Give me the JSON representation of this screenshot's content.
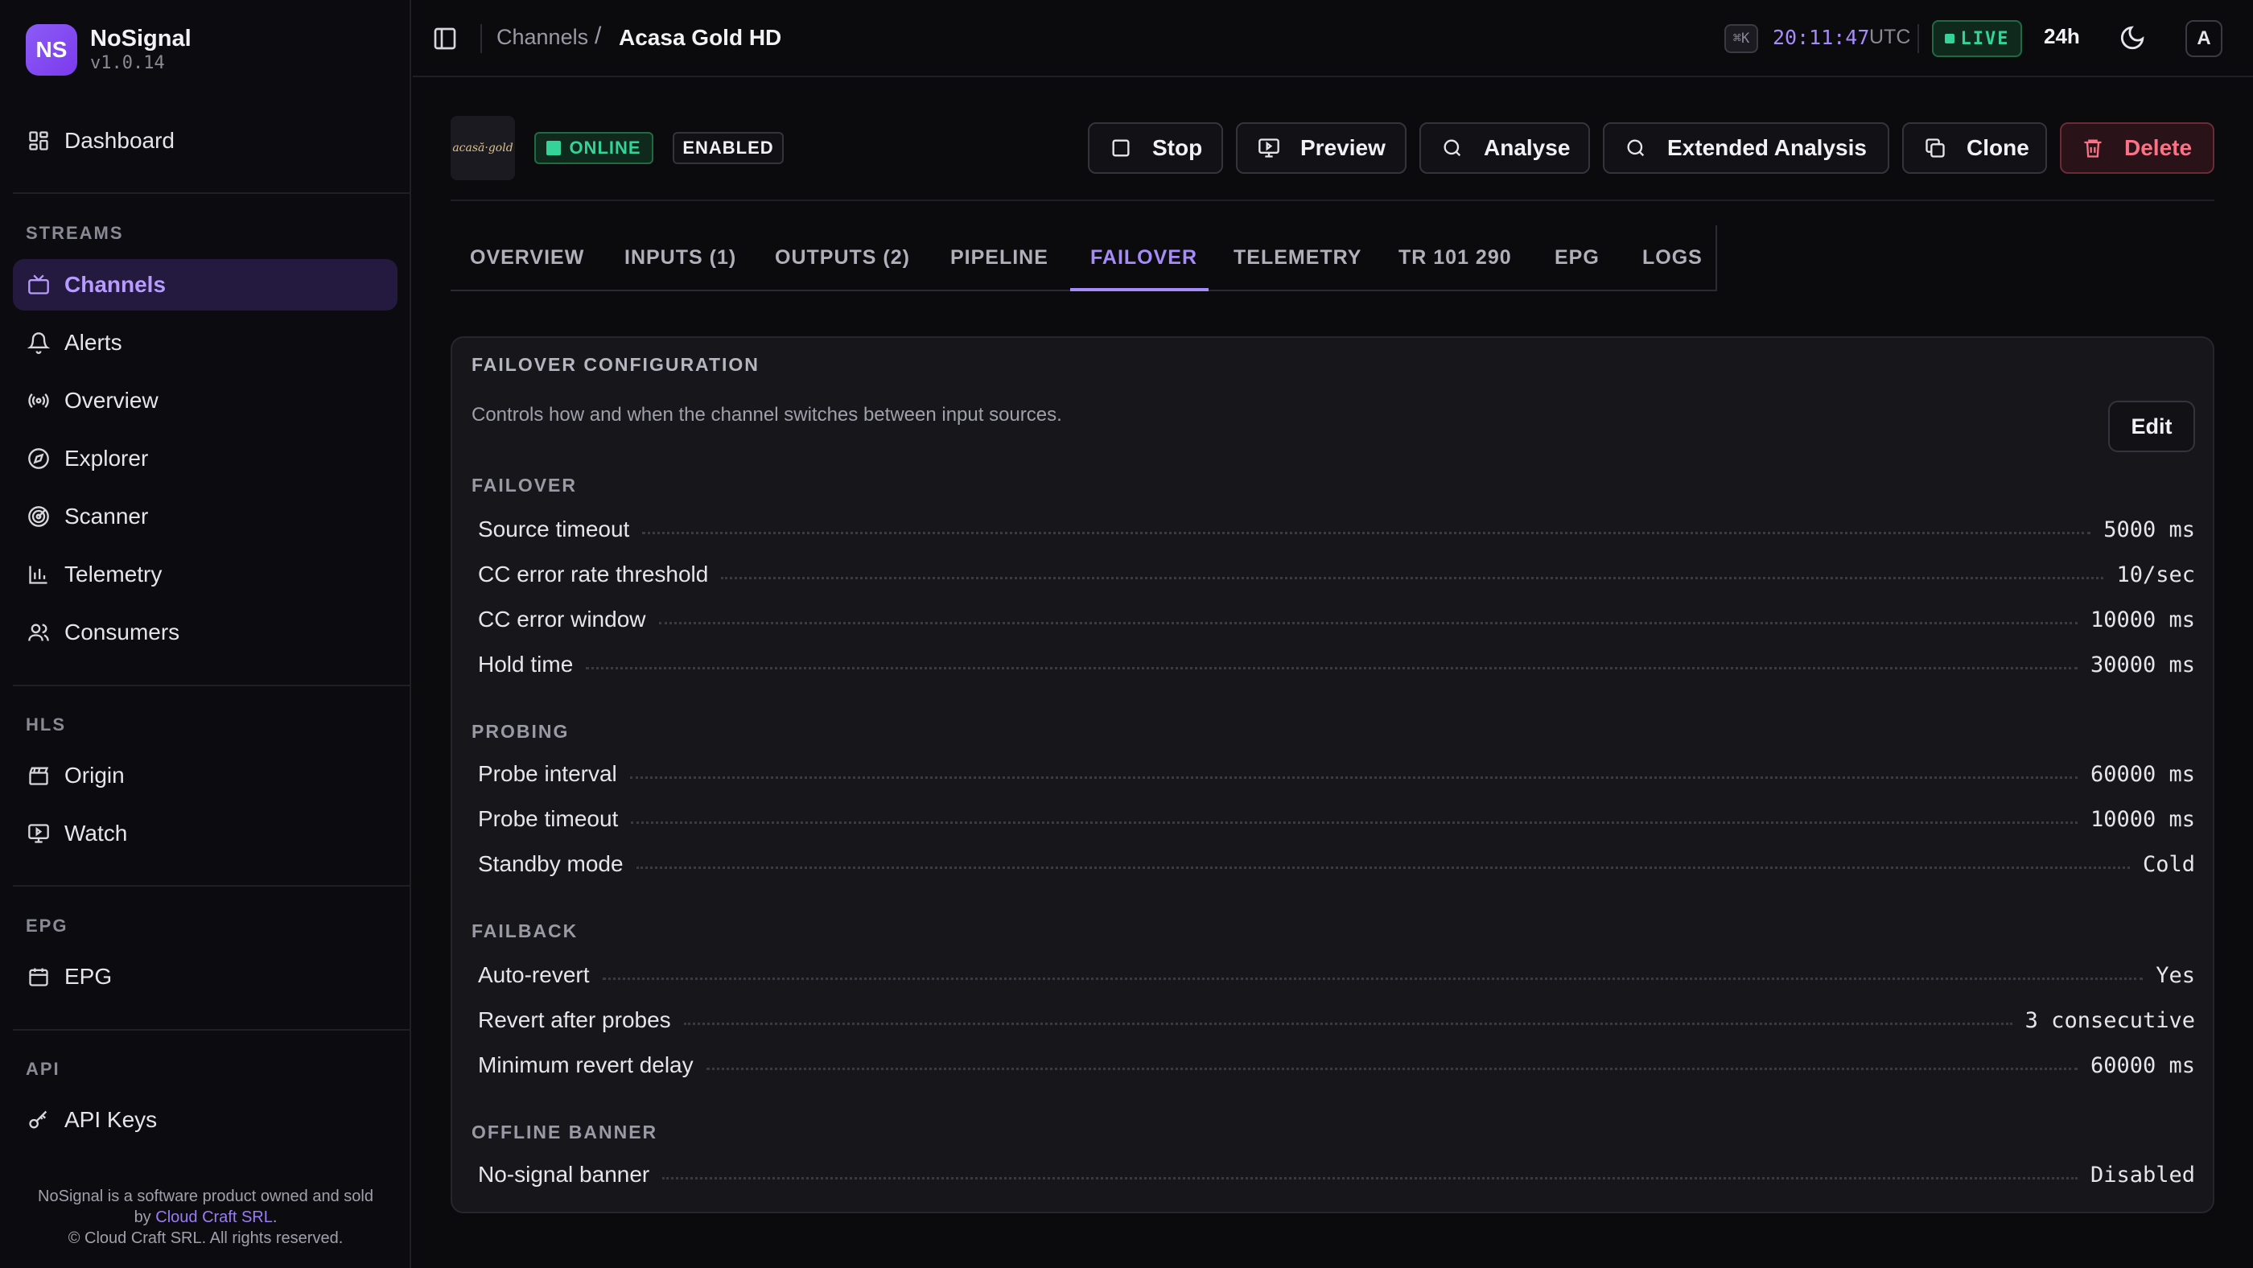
{
  "app": {
    "logo_text": "NS",
    "name": "NoSignal",
    "version": "v1.0.14"
  },
  "sidebar": {
    "dashboard": "Dashboard",
    "sections": {
      "streams": "STREAMS",
      "hls": "HLS",
      "epg": "EPG",
      "api": "API"
    },
    "streams_items": [
      "Channels",
      "Alerts",
      "Overview",
      "Explorer",
      "Scanner",
      "Telemetry",
      "Consumers"
    ],
    "hls_items": [
      "Origin",
      "Watch"
    ],
    "epg_items": [
      "EPG"
    ],
    "api_items": [
      "API Keys"
    ],
    "footer": {
      "line1": "NoSignal is a software product owned and sold",
      "by": "by ",
      "company": "Cloud Craft SRL",
      "period": ".",
      "line3": "© Cloud Craft SRL. All rights reserved."
    }
  },
  "header": {
    "breadcrumb": [
      "Channels",
      "Acasa Gold HD"
    ],
    "breadcrumb_sep": "/",
    "shortcut": "⌘K",
    "clock": "20:11:47",
    "tz": "UTC",
    "live": "LIVE",
    "range": "24h",
    "avatar": "A"
  },
  "channel": {
    "logo_text": "acasă·gold",
    "status": "ONLINE",
    "state": "ENABLED",
    "actions": [
      "Stop",
      "Preview",
      "Analyse",
      "Extended Analysis",
      "Clone",
      "Delete"
    ]
  },
  "tabs": [
    "OVERVIEW",
    "INPUTS (1)",
    "OUTPUTS (2)",
    "PIPELINE",
    "FAILOVER",
    "TELEMETRY",
    "TR 101 290",
    "EPG",
    "LOGS"
  ],
  "active_tab": "FAILOVER",
  "config": {
    "title": "FAILOVER CONFIGURATION",
    "description": "Controls how and when the channel switches between input sources.",
    "edit": "Edit",
    "sections": [
      {
        "title": "FAILOVER",
        "rows": [
          {
            "label": "Source timeout",
            "value": "5000 ms"
          },
          {
            "label": "CC error rate threshold",
            "value": "10/sec"
          },
          {
            "label": "CC error window",
            "value": "10000 ms"
          },
          {
            "label": "Hold time",
            "value": "30000 ms"
          }
        ]
      },
      {
        "title": "PROBING",
        "rows": [
          {
            "label": "Probe interval",
            "value": "60000 ms"
          },
          {
            "label": "Probe timeout",
            "value": "10000 ms"
          },
          {
            "label": "Standby mode",
            "value": "Cold"
          }
        ]
      },
      {
        "title": "FAILBACK",
        "rows": [
          {
            "label": "Auto-revert",
            "value": "Yes"
          },
          {
            "label": "Revert after probes",
            "value": "3 consecutive"
          },
          {
            "label": "Minimum revert delay",
            "value": "60000 ms"
          }
        ]
      },
      {
        "title": "OFFLINE BANNER",
        "rows": [
          {
            "label": "No-signal banner",
            "value": "Disabled"
          }
        ]
      }
    ]
  },
  "colors": {
    "accent": "#a78bfa",
    "success": "#34d399",
    "danger": "#fb7185",
    "background": "#0b0b0e"
  }
}
